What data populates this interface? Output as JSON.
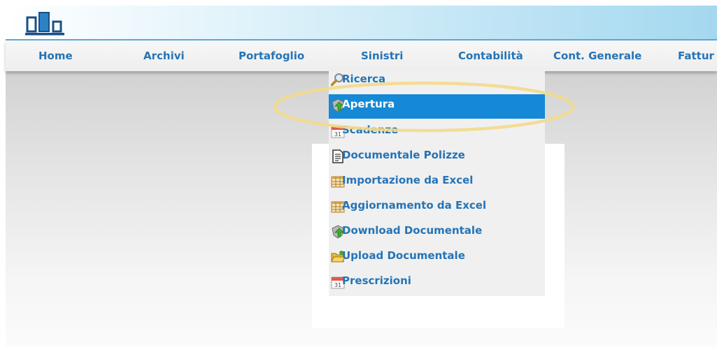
{
  "nav": {
    "items": [
      {
        "label": "Home"
      },
      {
        "label": "Archivi"
      },
      {
        "label": "Portafoglio"
      },
      {
        "label": "Sinistri"
      },
      {
        "label": "Contabilità"
      },
      {
        "label": "Cont. Generale"
      },
      {
        "label": "Fattur"
      }
    ],
    "active": "Sinistri"
  },
  "dropdown": {
    "items": [
      {
        "label": "Ricerca",
        "icon": "magnifier-icon"
      },
      {
        "label": "Apertura",
        "icon": "green-shield-icon"
      },
      {
        "label": "Scadenze",
        "icon": "calendar-icon"
      },
      {
        "label": "Documentale Polizze",
        "icon": "document-icon"
      },
      {
        "label": "Importazione da Excel",
        "icon": "spreadsheet-icon"
      },
      {
        "label": "Aggiornamento da Excel",
        "icon": "spreadsheet-icon"
      },
      {
        "label": "Download Documentale",
        "icon": "green-shield-icon"
      },
      {
        "label": "Upload Documentale",
        "icon": "folder-icon"
      },
      {
        "label": "Prescrizioni",
        "icon": "calendar-icon"
      }
    ],
    "selected": "Apertura"
  },
  "colors": {
    "link": "#2574b6",
    "selected_bg": "#1589d6",
    "highlight": "#f3d98a"
  }
}
